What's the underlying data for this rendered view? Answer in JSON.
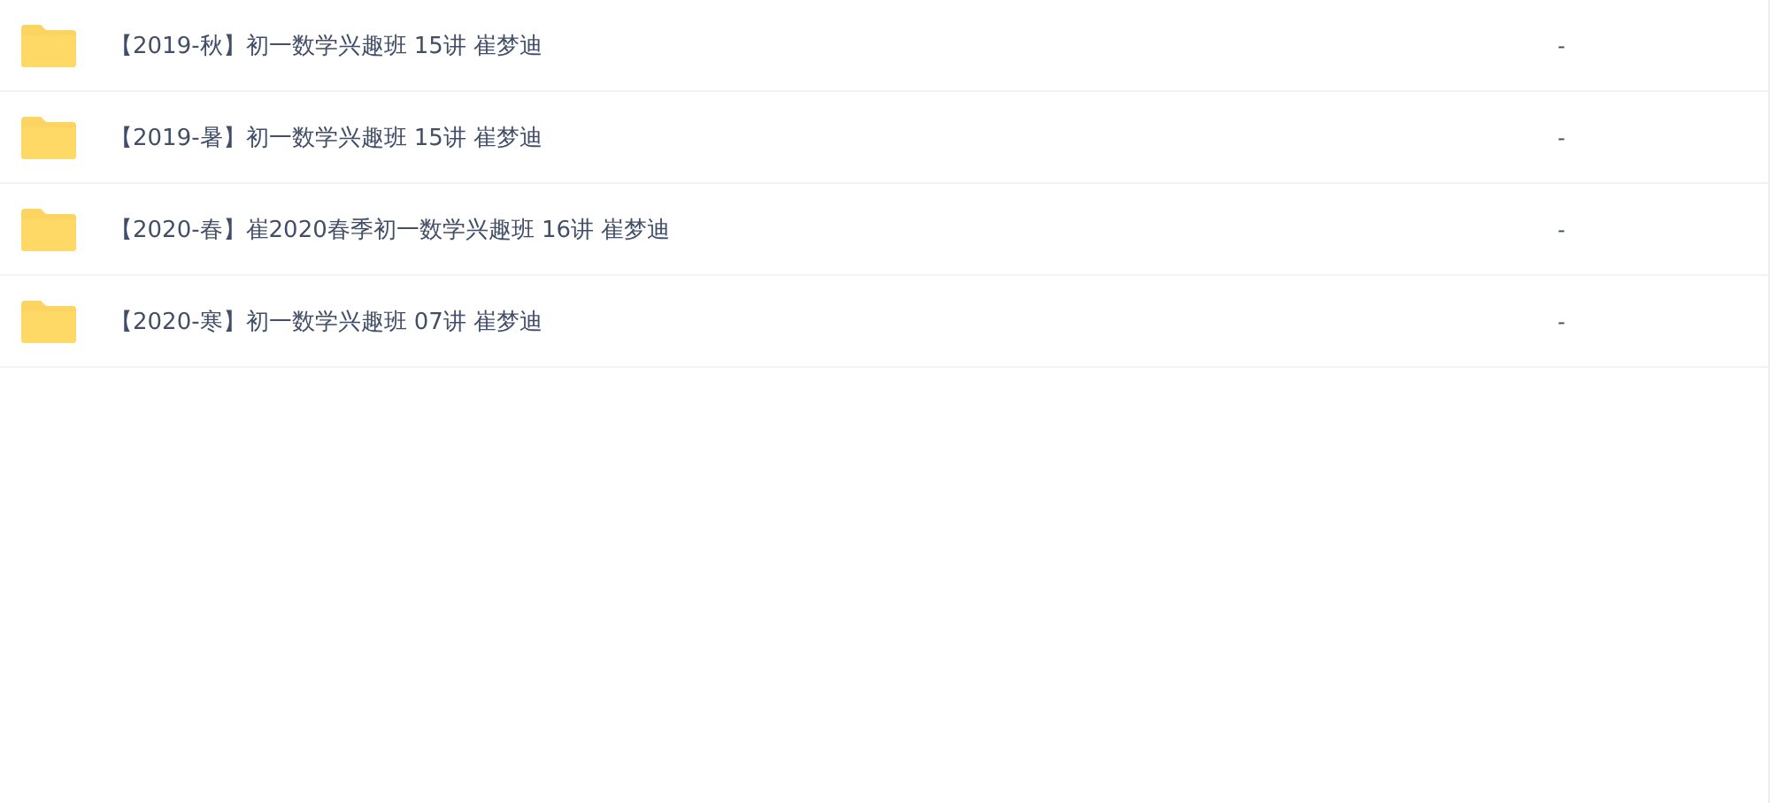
{
  "files": [
    {
      "kind": "folder",
      "name": "【2019-秋】初一数学兴趣班 15讲 崔梦迪",
      "size": "-"
    },
    {
      "kind": "folder",
      "name": "【2019-暑】初一数学兴趣班 15讲 崔梦迪",
      "size": "-"
    },
    {
      "kind": "folder",
      "name": "【2020-春】崔2020春季初一数学兴趣班 16讲 崔梦迪",
      "size": "-"
    },
    {
      "kind": "folder",
      "name": "【2020-寒】初一数学兴趣班 07讲 崔梦迪",
      "size": "-"
    }
  ]
}
